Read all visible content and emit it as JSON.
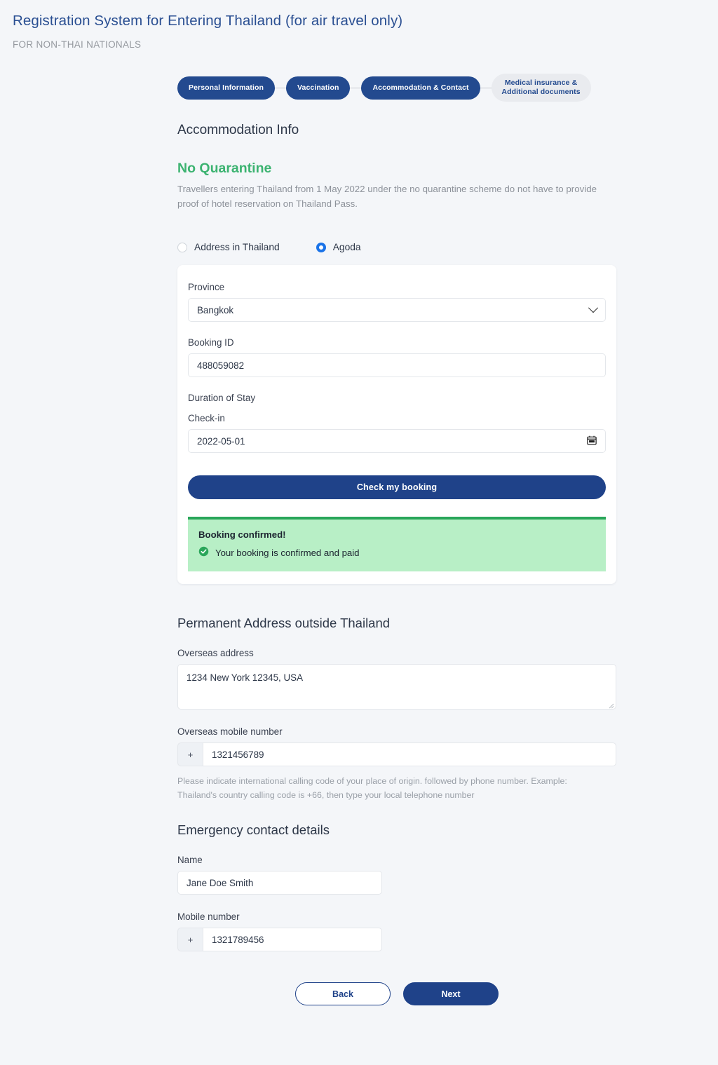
{
  "header": {
    "title": "Registration System for Entering Thailand (for air travel only)",
    "subtitle": "FOR NON-THAI NATIONALS"
  },
  "stepper": {
    "steps": [
      {
        "label": "Personal Information",
        "active": true
      },
      {
        "label": "Vaccination",
        "active": true
      },
      {
        "label": "Accommodation & Contact",
        "active": true
      },
      {
        "label": "Medical insurance & Additional documents",
        "active": false
      }
    ]
  },
  "accommodation": {
    "heading": "Accommodation Info",
    "quarantine_heading": "No Quarantine",
    "quarantine_note": "Travellers entering Thailand from 1 May 2022 under the no quarantine scheme do not have to provide proof of hotel reservation on Thailand Pass.",
    "options": [
      {
        "label": "Address in Thailand",
        "selected": false
      },
      {
        "label": "Agoda",
        "selected": true
      }
    ],
    "province_label": "Province",
    "province_value": "Bangkok",
    "booking_id_label": "Booking ID",
    "booking_id_value": "488059082",
    "duration_label": "Duration of Stay",
    "checkin_label": "Check-in",
    "checkin_value": "2022-05-01",
    "check_button": "Check my booking",
    "alert_title": "Booking confirmed!",
    "alert_message": "Your booking is confirmed and paid"
  },
  "permanent_address": {
    "heading": "Permanent Address outside Thailand",
    "overseas_address_label": "Overseas address",
    "overseas_address_value": "1234 New York 12345, USA",
    "overseas_mobile_label": "Overseas mobile number",
    "phone_prefix": "+",
    "overseas_mobile_value": "1321456789",
    "help_text": "Please indicate international calling code of your place of origin. followed by phone number. Example: Thailand's country calling code is +66, then type your local telephone number"
  },
  "emergency": {
    "heading": "Emergency contact details",
    "name_label": "Name",
    "name_value": "Jane Doe Smith",
    "mobile_label": "Mobile number",
    "phone_prefix": "+",
    "mobile_value": "1321789456"
  },
  "footer": {
    "back_label": "Back",
    "next_label": "Next"
  },
  "colors": {
    "brand_blue": "#1f4289",
    "step_blue": "#234a8f",
    "title_blue": "#2a4f92",
    "success_green": "#3cb371",
    "alert_bg": "#b8efc6",
    "alert_border": "#2aa65a",
    "radio_blue": "#1a73e8",
    "page_bg": "#f4f6f9"
  }
}
